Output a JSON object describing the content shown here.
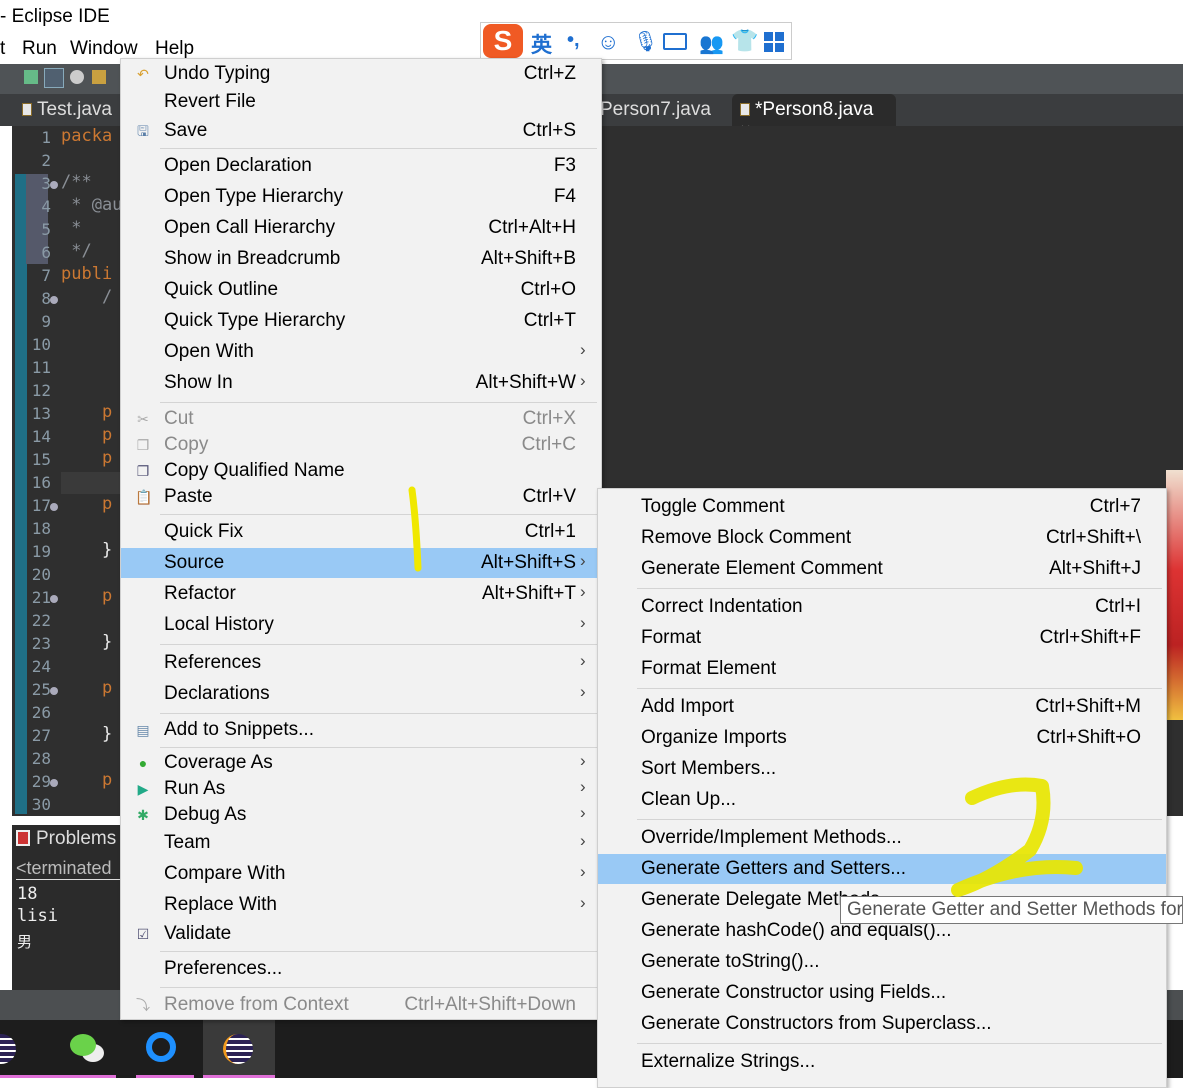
{
  "window": {
    "title": "- Eclipse IDE"
  },
  "menubar": [
    "t",
    "Run",
    "Window",
    "Help"
  ],
  "ime": {
    "language": "英",
    "punct": "•,",
    "icons": [
      "sogou-logo-icon",
      "emoji-icon",
      "microphone-icon",
      "keyboard-icon",
      "user-icon",
      "skin-shirt-icon",
      "apps-grid-icon"
    ]
  },
  "tabs": [
    {
      "label": "Test.java",
      "active": false
    },
    {
      "label": "Person7.java",
      "active": false
    },
    {
      "label": "*Person8.java",
      "active": true,
      "close": "×"
    }
  ],
  "editor": {
    "line_numbers": [
      "1",
      "2",
      "3",
      "4",
      "5",
      "6",
      "7",
      "8",
      "9",
      "10",
      "11",
      "12",
      "13",
      "14",
      "15",
      "16",
      "17",
      "18",
      "19",
      "20",
      "21",
      "22",
      "23",
      "24",
      "25",
      "26",
      "27",
      "28",
      "29",
      "30"
    ],
    "folds": [
      "3",
      "8",
      "17",
      "21",
      "25",
      "29"
    ],
    "code": [
      {
        "line": 1,
        "text": "packa"
      },
      {
        "line": 3,
        "text": "/**"
      },
      {
        "line": 4,
        "text": " * @au"
      },
      {
        "line": 5,
        "text": " *"
      },
      {
        "line": 6,
        "text": " */"
      },
      {
        "line": 7,
        "text": "publi"
      },
      {
        "line": 8,
        "text": "    /"
      },
      {
        "line": 13,
        "text": "    p"
      },
      {
        "line": 14,
        "text": "    p"
      },
      {
        "line": 15,
        "text": "    p"
      },
      {
        "line": 17,
        "text": "    p"
      },
      {
        "line": 19,
        "text": "    }"
      },
      {
        "line": 21,
        "text": "    p"
      },
      {
        "line": 23,
        "text": "    }"
      },
      {
        "line": 25,
        "text": "    p"
      },
      {
        "line": 27,
        "text": "    }"
      },
      {
        "line": 29,
        "text": "    p"
      }
    ]
  },
  "problems": {
    "tab_label": "Problems",
    "console_header": "<terminated",
    "console_lines": [
      "18",
      "lisi",
      "男"
    ]
  },
  "context_menu": {
    "items": [
      {
        "label": "Undo Typing",
        "shortcut": "Ctrl+Z",
        "icon": "undo-icon"
      },
      {
        "label": "Revert File"
      },
      {
        "label": "Save",
        "shortcut": "Ctrl+S",
        "icon": "save-icon"
      },
      {
        "sep": true
      },
      {
        "label": "Open Declaration",
        "shortcut": "F3"
      },
      {
        "label": "Open Type Hierarchy",
        "shortcut": "F4"
      },
      {
        "label": "Open Call Hierarchy",
        "shortcut": "Ctrl+Alt+H"
      },
      {
        "label": "Show in Breadcrumb",
        "shortcut": "Alt+Shift+B"
      },
      {
        "label": "Quick Outline",
        "shortcut": "Ctrl+O"
      },
      {
        "label": "Quick Type Hierarchy",
        "shortcut": "Ctrl+T"
      },
      {
        "label": "Open With",
        "submenu": true
      },
      {
        "label": "Show In",
        "shortcut": "Alt+Shift+W",
        "submenu": true
      },
      {
        "sep": true
      },
      {
        "label": "Cut",
        "shortcut": "Ctrl+X",
        "icon": "cut-icon",
        "disabled": true
      },
      {
        "label": "Copy",
        "shortcut": "Ctrl+C",
        "icon": "copy-icon",
        "disabled": true
      },
      {
        "label": "Copy Qualified Name",
        "icon": "copy-qualified-icon"
      },
      {
        "label": "Paste",
        "shortcut": "Ctrl+V",
        "icon": "paste-icon"
      },
      {
        "sep": true
      },
      {
        "label": "Quick Fix",
        "shortcut": "Ctrl+1"
      },
      {
        "label": "Source",
        "shortcut": "Alt+Shift+S",
        "submenu": true,
        "highlighted": true
      },
      {
        "label": "Refactor",
        "shortcut": "Alt+Shift+T",
        "submenu": true
      },
      {
        "label": "Local History",
        "submenu": true
      },
      {
        "sep": true
      },
      {
        "label": "References",
        "submenu": true
      },
      {
        "label": "Declarations",
        "submenu": true
      },
      {
        "sep": true
      },
      {
        "label": "Add to Snippets...",
        "icon": "snippets-icon"
      },
      {
        "sep": true
      },
      {
        "label": "Coverage As",
        "submenu": true,
        "icon": "coverage-icon"
      },
      {
        "label": "Run As",
        "submenu": true,
        "icon": "run-icon"
      },
      {
        "label": "Debug As",
        "submenu": true,
        "icon": "debug-icon"
      },
      {
        "label": "Team",
        "submenu": true
      },
      {
        "label": "Compare With",
        "submenu": true
      },
      {
        "label": "Replace With",
        "submenu": true
      },
      {
        "label": "Validate",
        "icon": "checkbox-icon"
      },
      {
        "sep": true
      },
      {
        "label": "Preferences..."
      },
      {
        "sep": true
      },
      {
        "label": "Remove from Context",
        "shortcut": "Ctrl+Alt+Shift+Down",
        "disabled": true,
        "icon": "remove-context-icon"
      }
    ]
  },
  "source_submenu": {
    "items": [
      {
        "label": "Toggle Comment",
        "shortcut": "Ctrl+7"
      },
      {
        "label": "Remove Block Comment",
        "shortcut": "Ctrl+Shift+\\"
      },
      {
        "label": "Generate Element Comment",
        "shortcut": "Alt+Shift+J"
      },
      {
        "sep": true
      },
      {
        "label": "Correct Indentation",
        "shortcut": "Ctrl+I"
      },
      {
        "label": "Format",
        "shortcut": "Ctrl+Shift+F"
      },
      {
        "label": "Format Element"
      },
      {
        "sep": true
      },
      {
        "label": "Add Import",
        "shortcut": "Ctrl+Shift+M"
      },
      {
        "label": "Organize Imports",
        "shortcut": "Ctrl+Shift+O"
      },
      {
        "label": "Sort Members..."
      },
      {
        "label": "Clean Up..."
      },
      {
        "sep": true
      },
      {
        "label": "Override/Implement Methods..."
      },
      {
        "label": "Generate Getters and Setters...",
        "highlighted": true
      },
      {
        "label": "Generate Delegate Methods..."
      },
      {
        "label": "Generate hashCode() and equals()..."
      },
      {
        "label": "Generate toString()..."
      },
      {
        "label": "Generate Constructor using Fields..."
      },
      {
        "label": "Generate Constructors from Superclass..."
      },
      {
        "sep": true
      },
      {
        "label": "Externalize Strings..."
      }
    ]
  },
  "tooltip": "Generate Getter and Setter Methods for",
  "annotations": [
    "1",
    "2"
  ],
  "taskbar": [
    "eclipse-icon",
    "wechat-icon",
    "qq-browser-icon",
    "eclipse-icon"
  ],
  "colors": {
    "highlight": "#99c9f5",
    "annotation": "#f0e800",
    "keyword": "#cc7832",
    "editor_bg": "#2f2f2f"
  }
}
